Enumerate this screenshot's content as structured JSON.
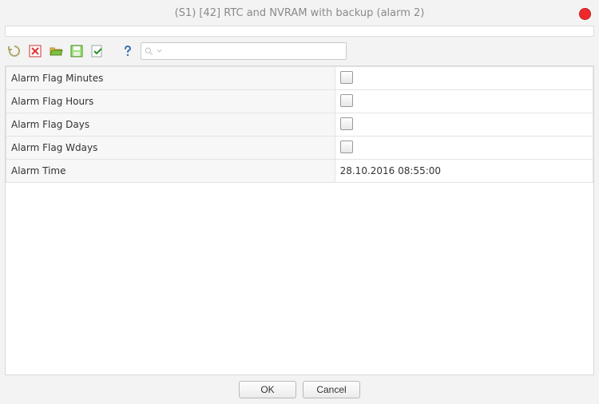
{
  "window": {
    "title": "(S1) [42] RTC and NVRAM with backup (alarm 2)"
  },
  "toolbar": {
    "icons": {
      "undo": "undo-icon",
      "discard": "discard-changes-icon",
      "open": "open-folder-icon",
      "save": "save-icon",
      "apply": "apply-check-icon",
      "help": "help-icon",
      "search": "search-icon",
      "search_more": "chevron-down-icon"
    },
    "search_value": ""
  },
  "properties": [
    {
      "label": "Alarm Flag Minutes",
      "type": "checkbox",
      "checked": false
    },
    {
      "label": "Alarm Flag Hours",
      "type": "checkbox",
      "checked": false
    },
    {
      "label": "Alarm Flag Days",
      "type": "checkbox",
      "checked": false
    },
    {
      "label": "Alarm Flag Wdays",
      "type": "checkbox",
      "checked": false
    },
    {
      "label": "Alarm Time",
      "type": "text",
      "value": "28.10.2016 08:55:00"
    }
  ],
  "footer": {
    "ok_label": "OK",
    "cancel_label": "Cancel"
  }
}
